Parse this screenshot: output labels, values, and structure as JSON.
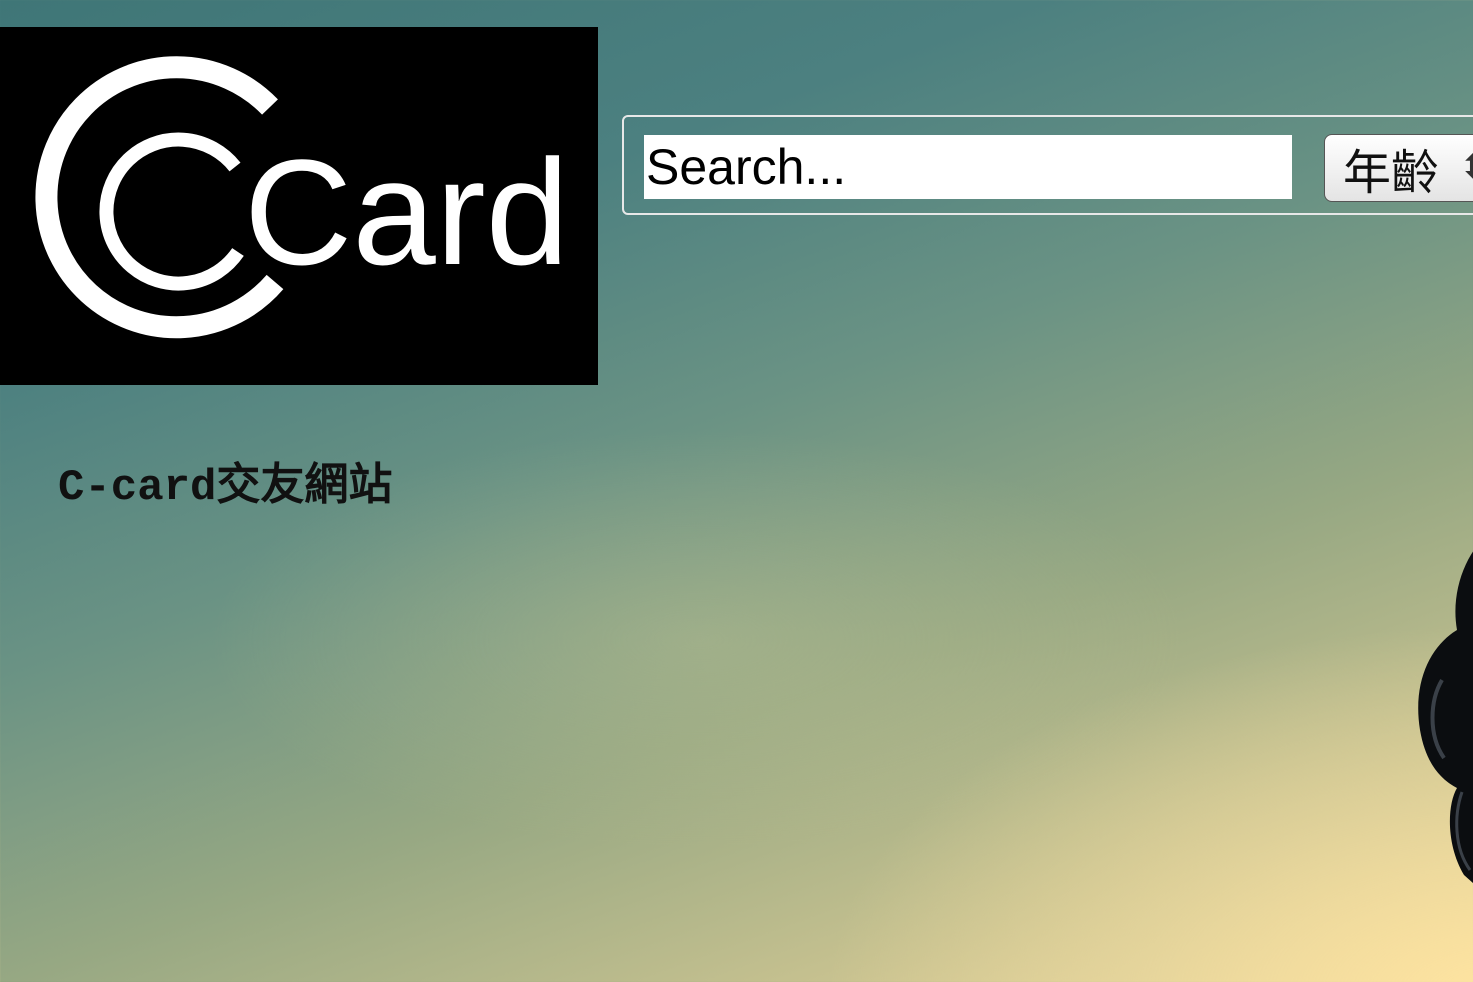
{
  "logo": {
    "text": "Card"
  },
  "site_title": "C-card交友網站",
  "search": {
    "placeholder": "Search..."
  },
  "age_filter": {
    "selected": "年齡"
  },
  "colors": {
    "logo_background": "#000000",
    "logo_foreground": "#ffffff",
    "sky_top": "#3f7677",
    "sky_bottom": "#efd99e"
  }
}
